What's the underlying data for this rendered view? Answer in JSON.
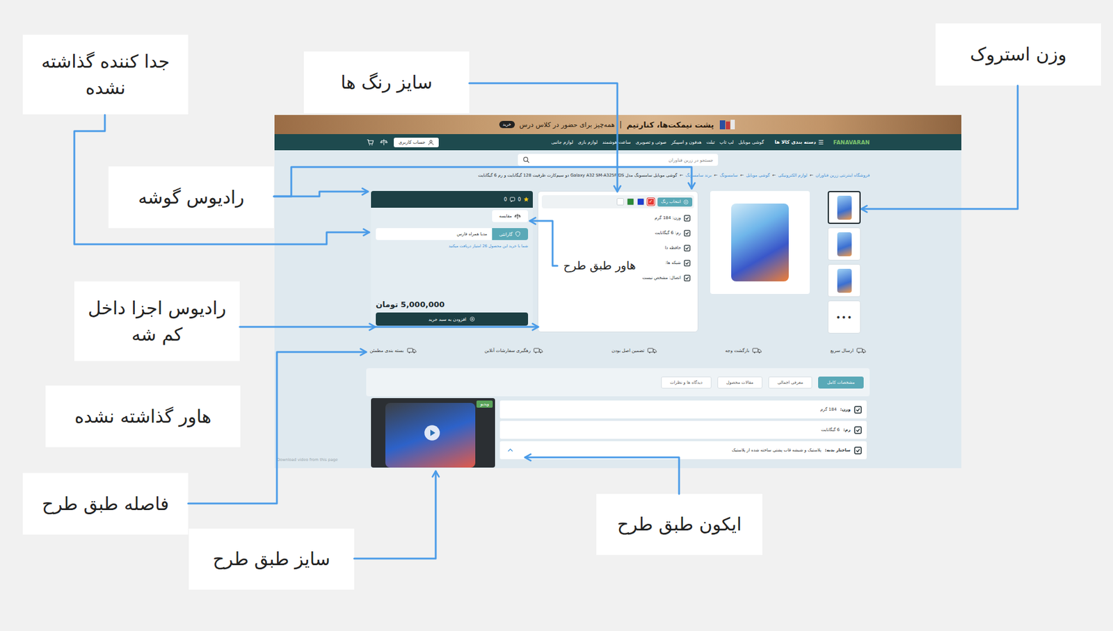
{
  "annotations": [
    {
      "text": "جدا کننده گذاشته نشده"
    },
    {
      "text": "سایز رنگ ها"
    },
    {
      "text": "وزن استروک"
    },
    {
      "text": "رادیوس گوشه"
    },
    {
      "text": "هاور طبق طرح"
    },
    {
      "text": "رادیوس اجزا داخل کم شه"
    },
    {
      "text": "هاور گذاشته نشده"
    },
    {
      "text": "فاصله طبق طرح"
    },
    {
      "text": "سایز طبق طرح"
    },
    {
      "text": "ایکون طبق طرح"
    }
  ],
  "page": {
    "banner": {
      "title": "پشت نیمکت‌ها، کنارتیم",
      "separator": "|",
      "subtitle": "همه‌چیز برای حضور در کلاس درس",
      "badge": "خرید"
    },
    "nav": {
      "logo": "FANAVARAN",
      "menu_icon": "☰",
      "categories": "دسته بندی کالا ها",
      "items": [
        "گوشی موبایل",
        "لپ تاپ",
        "تبلت",
        "هدفون و اسپیکر",
        "صوتی و تصویری",
        "ساعت هوشمند",
        "لوازم بازی",
        "لوازم جانبی"
      ],
      "account": "حساب کاربری"
    },
    "search": {
      "placeholder": "جستجو در زرین فناوران"
    },
    "breadcrumb": {
      "separator": "←",
      "items": [
        "فروشگاه اینترنتی زرین فناوران",
        "لوازم الکترونیکی",
        "گوشی موبایل",
        "سامسونگ",
        "برند سامسونگ"
      ],
      "current": "گوشی موبایل سامسونگ مدل Galaxy A32 SM-A325F/DS دو سیم‌کارت ظرفیت 128 گیگابایت و رم 6 گیگابایت"
    },
    "gallery": {
      "thumbnails": [
        {
          "kind": "image",
          "selected": true,
          "label": ""
        },
        {
          "kind": "image",
          "selected": false,
          "label": ""
        },
        {
          "kind": "image",
          "selected": false,
          "label": ""
        },
        {
          "kind": "more",
          "selected": false,
          "label": "•••"
        }
      ]
    },
    "colors": {
      "button": "انتخاب رنگ",
      "check": "✓",
      "swatches": [
        {
          "color": "#e53935",
          "selected": true
        },
        {
          "color": "#1f3fcf",
          "selected": false
        },
        {
          "color": "#2e8b3a",
          "selected": false
        },
        {
          "color": "#ffffff",
          "selected": false
        }
      ]
    },
    "specs": [
      "وزن: 184 گرم",
      "رم: 6 گیگابایت",
      "حافظه ذا",
      "شبکه ها:",
      "اتصال: مشخص نیست"
    ],
    "buy": {
      "rating": "0",
      "comments": "0",
      "compare": "مقایسه",
      "warranty_label": "گارانتی",
      "warranty_value": "مدیا همراه فارس",
      "points": "شما با خرید این محصول 26 امتیاز دریافت میکنید",
      "price": "5,000,000 تومان",
      "add_to_cart": "افزودن به سبد خرید"
    },
    "features": [
      "ارسال سریع",
      "بازگشت وجه",
      "تضمین اصل بودن",
      "رهگیری سفارشات آنلاین",
      "بسته بندی مطمئن"
    ],
    "tabs": [
      {
        "label": "مشخصات کامل",
        "selected": true
      },
      {
        "label": "معرفی اجمالی",
        "selected": false
      },
      {
        "label": "مقالات محصول",
        "selected": false
      },
      {
        "label": "دیدگاه ها و نظرات",
        "selected": false
      }
    ],
    "details": [
      {
        "label": "وزن:",
        "value": "184 گرم",
        "expandable": false
      },
      {
        "label": "رم:",
        "value": "6 گیگابایت",
        "expandable": false
      },
      {
        "label": "ساختار بدنه:",
        "value": "پلاستیک و شیشه قاب پشتی ساخته شده از پلاستیک",
        "expandable": true
      }
    ],
    "video": {
      "badge": "ویدیو"
    },
    "watermark": "Download video from this page"
  }
}
